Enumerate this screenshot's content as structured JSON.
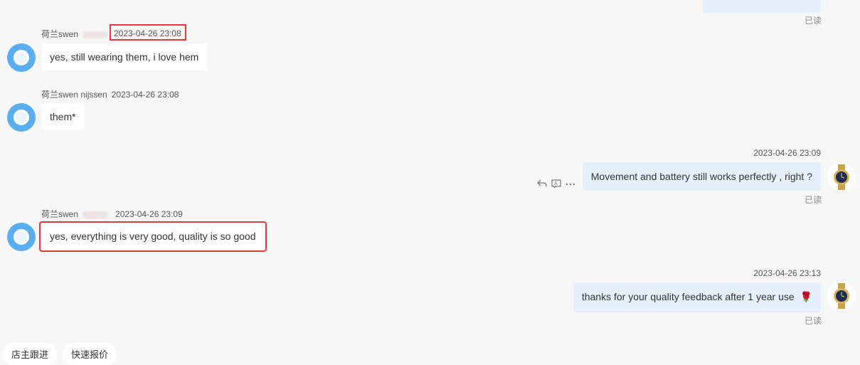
{
  "read_receipt": "已读",
  "messages": [
    {
      "side": "left",
      "sender": "荷兰swen",
      "time": "2023-04-26 23:08",
      "text": "yes, still wearing them, i love hem"
    },
    {
      "side": "left",
      "sender": "荷兰swen nijssen",
      "time": "2023-04-26 23:08",
      "text": "them*"
    },
    {
      "side": "right",
      "time": "2023-04-26 23:09",
      "text": "Movement and battery still works perfectly , right ?"
    },
    {
      "side": "left",
      "sender": "荷兰swen",
      "time": "2023-04-26 23:09",
      "text": "yes, everything is very good, quality is so good"
    },
    {
      "side": "right",
      "time": "2023-04-26 23:13",
      "text": "thanks for your quality feedback after 1 year use",
      "emoji": "🌹"
    }
  ],
  "quick_chips": [
    "店主跟进",
    "快速报价"
  ],
  "icons": {
    "left_avatar": "app-avatar-icon",
    "right_avatar": "gold-watch-icon",
    "reply": "reply-icon",
    "translate": "translate-icon",
    "more": "more-icon"
  },
  "colors": {
    "highlight": "#e03a3a",
    "bubble_right": "#e6f0fc",
    "avatar_blue": "#5aaef0"
  }
}
